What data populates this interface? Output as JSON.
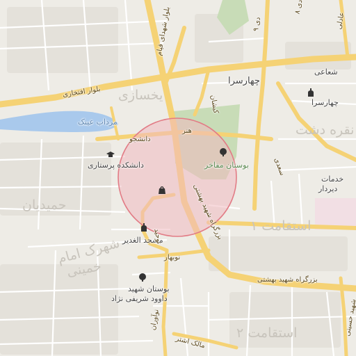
{
  "map": {
    "center_marker": {
      "icon": "shopping-bag-icon",
      "color": "#e8a3a8",
      "stroke": "#e27c86"
    },
    "colors": {
      "land": "#eeece6",
      "major_road": "#f5d275",
      "minor_road": "#ffffff",
      "water": "#a9c9ec",
      "park": "#c8dcb7",
      "building_zone": "#e2dfd8"
    },
    "labels": {
      "boulevard_eftekhari": "بلوار افتخاری",
      "boulevard_shohada": "بلوار شهدای قیام",
      "dey_8": "۸ دی",
      "dey_9": "۹ دی",
      "adeli": "عادلی",
      "chaharsara_road": "چهارسرا",
      "chaharsara_poi": "چهارسرا",
      "shoaie": "شعاعی",
      "yakhsazi": "یخسازی",
      "kishan": "کیشان",
      "mordab_eynak": "مرداب عینک",
      "honar": "هنر",
      "daneshjoo": "دانشجو",
      "parastari": "دانشکده پرستاری",
      "boostan_mafakher": "بوستان مفاخر",
      "hamidian": "حمیدیان",
      "masjed_ghadir": "مسجد الغدیر",
      "shahrak_imam": "شهرک امام",
      "khomeini": "خمینی",
      "tohid": "توحید",
      "nobahar": "نوبهار",
      "bozorgrah_beheshti_vertical": "بزرگراه شهید بهشتی",
      "bozorgrah_beheshti": "بزرگراه شهید بهشتی",
      "boostan_shahid": "بوستان شهید",
      "davood_sharifi": "داوود شریفی نژاد",
      "noavaran": "نوآوران",
      "estegamat_1": "استقامت ۱",
      "estegamat_2": "استقامت ۲",
      "khadamat": "خدمات",
      "dirdaz": "دیردار",
      "noghre_dasht": "نقره دشت",
      "saadi": "سعدی",
      "mallek_ashtar": "مالک اشتر",
      "shoun_hosseini": "شهید حسینی"
    }
  }
}
